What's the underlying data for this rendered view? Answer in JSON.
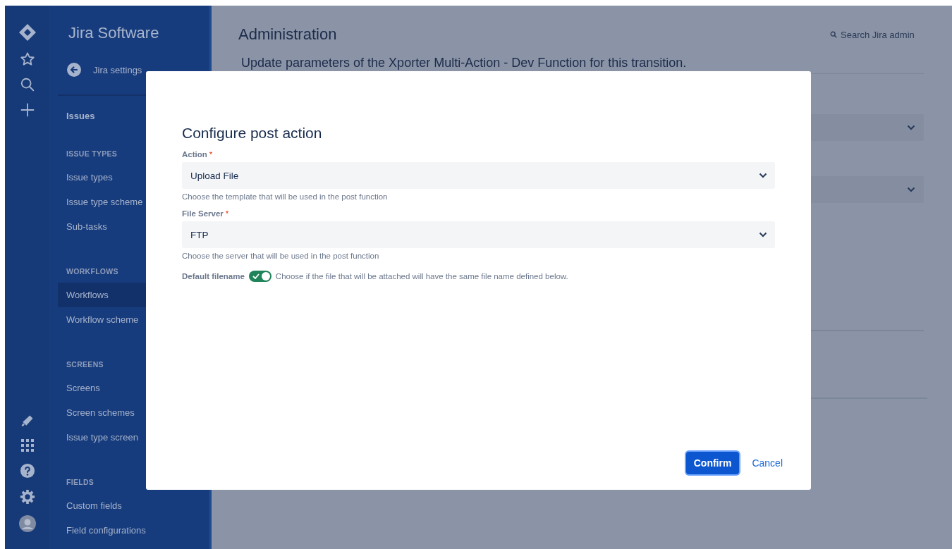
{
  "product": {
    "name": "Jira Software"
  },
  "sidebar": {
    "back_link": "Jira settings",
    "heading": "Issues",
    "sections": [
      {
        "title": "ISSUE TYPES",
        "items": [
          {
            "label": "Issue types",
            "selected": false
          },
          {
            "label": "Issue type scheme",
            "selected": false
          },
          {
            "label": "Sub-tasks",
            "selected": false
          }
        ]
      },
      {
        "title": "WORKFLOWS",
        "items": [
          {
            "label": "Workflows",
            "selected": true
          },
          {
            "label": "Workflow scheme",
            "selected": false
          }
        ]
      },
      {
        "title": "SCREENS",
        "items": [
          {
            "label": "Screens",
            "selected": false
          },
          {
            "label": "Screen schemes",
            "selected": false
          },
          {
            "label": "Issue type screen",
            "selected": false
          }
        ]
      },
      {
        "title": "FIELDS",
        "items": [
          {
            "label": "Custom fields",
            "selected": false
          },
          {
            "label": "Field configurations",
            "selected": false
          }
        ]
      }
    ]
  },
  "page": {
    "title": "Administration",
    "search": {
      "placeholder": "Search Jira admin"
    },
    "subtitle": "Update parameters of the Xporter Multi-Action - Dev Function for this transition."
  },
  "dialog": {
    "title": "Configure post action",
    "fields": [
      {
        "label": "Action",
        "required_mark": "*",
        "value": "Upload File",
        "help": "Choose the template that will be used in the post function"
      },
      {
        "label": "File Server",
        "required_mark": "*",
        "value": "FTP",
        "help": "Choose the server that will be used in the post function"
      }
    ],
    "toggle": {
      "label": "Default filename",
      "checked": true,
      "description": "Choose if the file that will be attached will have the same file name defined below."
    },
    "buttons": [
      {
        "kind": "primary",
        "label": "Confirm"
      },
      {
        "kind": "link",
        "label": "Cancel"
      }
    ]
  }
}
